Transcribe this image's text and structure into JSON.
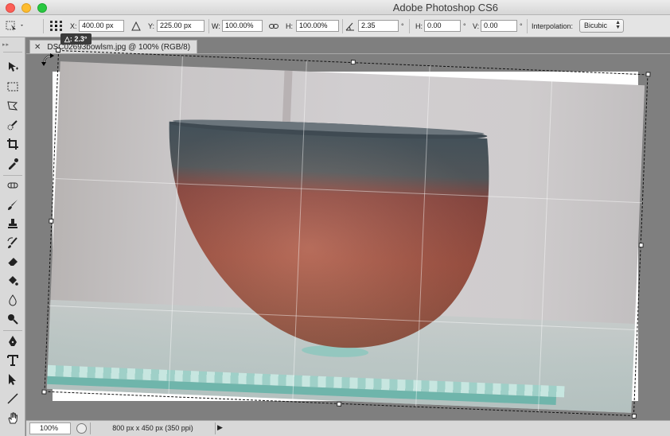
{
  "window": {
    "app_title": "Adobe Photoshop CS6"
  },
  "options_bar": {
    "x_label": "X:",
    "x_value": "400.00 px",
    "y_label": "Y:",
    "y_value": "225.00 px",
    "w_label": "W:",
    "w_value": "100.00%",
    "h_label": "H:",
    "h_value": "100.00%",
    "angle_value": "2.35",
    "angle_unit": "°",
    "hskew_label": "H:",
    "hskew_value": "0.00",
    "hskew_unit": "°",
    "vskew_label": "V:",
    "vskew_value": "0.00",
    "vskew_unit": "°",
    "interpolation_label": "Interpolation:",
    "interpolation_value": "Bicubic"
  },
  "document": {
    "tab_title": "DSC02693bowlsm.jpg @ 100% (RGB/8)",
    "rotation_tooltip": "△: 2.3°"
  },
  "status_bar": {
    "zoom": "100%",
    "doc_info": "800 px x 450 px (350 ppi)"
  },
  "tools": [
    "move-tool",
    "marquee-tool",
    "lasso-tool",
    "quick-selection-tool",
    "crop-tool",
    "eyedropper-tool",
    "healing-brush-tool",
    "brush-tool",
    "clone-stamp-tool",
    "history-brush-tool",
    "eraser-tool",
    "paint-bucket-tool",
    "blur-tool",
    "dodge-tool",
    "pen-tool",
    "type-tool",
    "path-selection-tool",
    "line-tool",
    "hand-tool"
  ]
}
